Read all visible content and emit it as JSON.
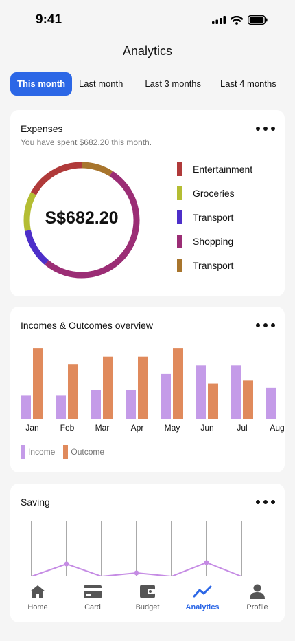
{
  "status": {
    "time": "9:41"
  },
  "page": {
    "title": "Analytics"
  },
  "tabs": [
    {
      "label": "This month",
      "active": true
    },
    {
      "label": "Last month",
      "active": false
    },
    {
      "label": "Last 3 months",
      "active": false
    },
    {
      "label": "Last 4 months",
      "active": false
    }
  ],
  "expenses": {
    "title": "Expenses",
    "subtitle": "You have spent $682.20 this month.",
    "total": "S$682.20",
    "legend": [
      {
        "label": "Entertainment",
        "color": "#b03a3a"
      },
      {
        "label": "Groceries",
        "color": "#b4bd33"
      },
      {
        "label": "Transport",
        "color": "#4d2fc9"
      },
      {
        "label": "Shopping",
        "color": "#9b2d75"
      },
      {
        "label": "Transport",
        "color": "#a8752d"
      }
    ],
    "segments": [
      {
        "color": "#a8752d",
        "fraction": 0.09
      },
      {
        "color": "#9b2d75",
        "fraction": 0.52
      },
      {
        "color": "#4d2fc9",
        "fraction": 0.11
      },
      {
        "color": "#b4bd33",
        "fraction": 0.11
      },
      {
        "color": "#b03a3a",
        "fraction": 0.17
      }
    ]
  },
  "overview": {
    "title": "Incomes & Outcomes overview",
    "legend_income": "Income",
    "legend_outcome": "Outcome",
    "income_color": "#c49be8",
    "outcome_color": "#e08a5c"
  },
  "saving": {
    "title": "Saving",
    "line_color": "#c58be4"
  },
  "chart_data": [
    {
      "type": "bar",
      "categories": [
        "Jan",
        "Feb",
        "Mar",
        "Apr",
        "May",
        "Jun",
        "Jul",
        "Aug"
      ],
      "series": [
        {
          "name": "Income",
          "values": [
            32,
            32,
            40,
            40,
            62,
            74,
            74,
            43
          ]
        },
        {
          "name": "Outcome",
          "values": [
            98,
            76,
            86,
            86,
            98,
            49,
            53,
            0
          ]
        }
      ],
      "ylim": [
        0,
        100
      ]
    },
    {
      "type": "line",
      "x": [
        0,
        1,
        2,
        3,
        4,
        5,
        6
      ],
      "values": [
        0,
        18,
        0,
        5,
        0,
        20,
        0
      ],
      "ylim": [
        0,
        100
      ]
    }
  ],
  "nav": [
    {
      "label": "Home",
      "icon": "home-icon",
      "active": false
    },
    {
      "label": "Card",
      "icon": "card-icon",
      "active": false
    },
    {
      "label": "Budget",
      "icon": "wallet-icon",
      "active": false
    },
    {
      "label": "Analytics",
      "icon": "analytics-icon",
      "active": true
    },
    {
      "label": "Profile",
      "icon": "profile-icon",
      "active": false
    }
  ]
}
